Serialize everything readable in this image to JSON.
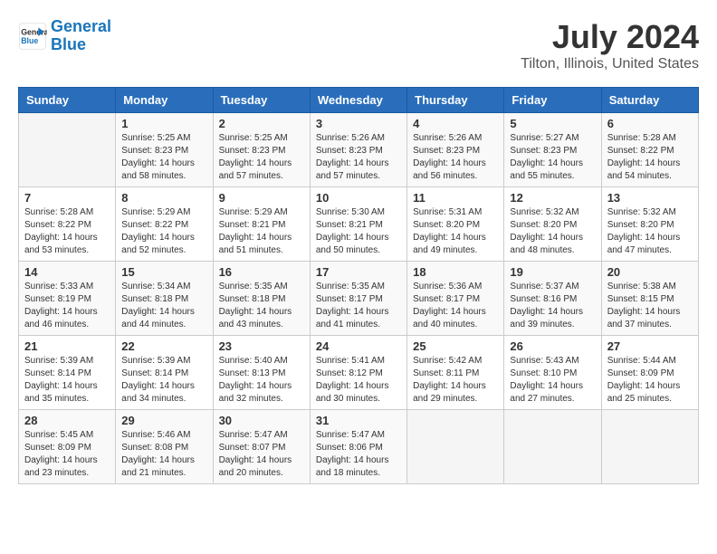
{
  "header": {
    "logo_line1": "General",
    "logo_line2": "Blue",
    "title": "July 2024",
    "subtitle": "Tilton, Illinois, United States"
  },
  "weekdays": [
    "Sunday",
    "Monday",
    "Tuesday",
    "Wednesday",
    "Thursday",
    "Friday",
    "Saturday"
  ],
  "weeks": [
    [
      {
        "day": "",
        "sunrise": "",
        "sunset": "",
        "daylight": ""
      },
      {
        "day": "1",
        "sunrise": "5:25 AM",
        "sunset": "8:23 PM",
        "daylight": "14 hours and 58 minutes."
      },
      {
        "day": "2",
        "sunrise": "5:25 AM",
        "sunset": "8:23 PM",
        "daylight": "14 hours and 57 minutes."
      },
      {
        "day": "3",
        "sunrise": "5:26 AM",
        "sunset": "8:23 PM",
        "daylight": "14 hours and 57 minutes."
      },
      {
        "day": "4",
        "sunrise": "5:26 AM",
        "sunset": "8:23 PM",
        "daylight": "14 hours and 56 minutes."
      },
      {
        "day": "5",
        "sunrise": "5:27 AM",
        "sunset": "8:23 PM",
        "daylight": "14 hours and 55 minutes."
      },
      {
        "day": "6",
        "sunrise": "5:28 AM",
        "sunset": "8:22 PM",
        "daylight": "14 hours and 54 minutes."
      }
    ],
    [
      {
        "day": "7",
        "sunrise": "5:28 AM",
        "sunset": "8:22 PM",
        "daylight": "14 hours and 53 minutes."
      },
      {
        "day": "8",
        "sunrise": "5:29 AM",
        "sunset": "8:22 PM",
        "daylight": "14 hours and 52 minutes."
      },
      {
        "day": "9",
        "sunrise": "5:29 AM",
        "sunset": "8:21 PM",
        "daylight": "14 hours and 51 minutes."
      },
      {
        "day": "10",
        "sunrise": "5:30 AM",
        "sunset": "8:21 PM",
        "daylight": "14 hours and 50 minutes."
      },
      {
        "day": "11",
        "sunrise": "5:31 AM",
        "sunset": "8:20 PM",
        "daylight": "14 hours and 49 minutes."
      },
      {
        "day": "12",
        "sunrise": "5:32 AM",
        "sunset": "8:20 PM",
        "daylight": "14 hours and 48 minutes."
      },
      {
        "day": "13",
        "sunrise": "5:32 AM",
        "sunset": "8:20 PM",
        "daylight": "14 hours and 47 minutes."
      }
    ],
    [
      {
        "day": "14",
        "sunrise": "5:33 AM",
        "sunset": "8:19 PM",
        "daylight": "14 hours and 46 minutes."
      },
      {
        "day": "15",
        "sunrise": "5:34 AM",
        "sunset": "8:18 PM",
        "daylight": "14 hours and 44 minutes."
      },
      {
        "day": "16",
        "sunrise": "5:35 AM",
        "sunset": "8:18 PM",
        "daylight": "14 hours and 43 minutes."
      },
      {
        "day": "17",
        "sunrise": "5:35 AM",
        "sunset": "8:17 PM",
        "daylight": "14 hours and 41 minutes."
      },
      {
        "day": "18",
        "sunrise": "5:36 AM",
        "sunset": "8:17 PM",
        "daylight": "14 hours and 40 minutes."
      },
      {
        "day": "19",
        "sunrise": "5:37 AM",
        "sunset": "8:16 PM",
        "daylight": "14 hours and 39 minutes."
      },
      {
        "day": "20",
        "sunrise": "5:38 AM",
        "sunset": "8:15 PM",
        "daylight": "14 hours and 37 minutes."
      }
    ],
    [
      {
        "day": "21",
        "sunrise": "5:39 AM",
        "sunset": "8:14 PM",
        "daylight": "14 hours and 35 minutes."
      },
      {
        "day": "22",
        "sunrise": "5:39 AM",
        "sunset": "8:14 PM",
        "daylight": "14 hours and 34 minutes."
      },
      {
        "day": "23",
        "sunrise": "5:40 AM",
        "sunset": "8:13 PM",
        "daylight": "14 hours and 32 minutes."
      },
      {
        "day": "24",
        "sunrise": "5:41 AM",
        "sunset": "8:12 PM",
        "daylight": "14 hours and 30 minutes."
      },
      {
        "day": "25",
        "sunrise": "5:42 AM",
        "sunset": "8:11 PM",
        "daylight": "14 hours and 29 minutes."
      },
      {
        "day": "26",
        "sunrise": "5:43 AM",
        "sunset": "8:10 PM",
        "daylight": "14 hours and 27 minutes."
      },
      {
        "day": "27",
        "sunrise": "5:44 AM",
        "sunset": "8:09 PM",
        "daylight": "14 hours and 25 minutes."
      }
    ],
    [
      {
        "day": "28",
        "sunrise": "5:45 AM",
        "sunset": "8:09 PM",
        "daylight": "14 hours and 23 minutes."
      },
      {
        "day": "29",
        "sunrise": "5:46 AM",
        "sunset": "8:08 PM",
        "daylight": "14 hours and 21 minutes."
      },
      {
        "day": "30",
        "sunrise": "5:47 AM",
        "sunset": "8:07 PM",
        "daylight": "14 hours and 20 minutes."
      },
      {
        "day": "31",
        "sunrise": "5:47 AM",
        "sunset": "8:06 PM",
        "daylight": "14 hours and 18 minutes."
      },
      {
        "day": "",
        "sunrise": "",
        "sunset": "",
        "daylight": ""
      },
      {
        "day": "",
        "sunrise": "",
        "sunset": "",
        "daylight": ""
      },
      {
        "day": "",
        "sunrise": "",
        "sunset": "",
        "daylight": ""
      }
    ]
  ]
}
